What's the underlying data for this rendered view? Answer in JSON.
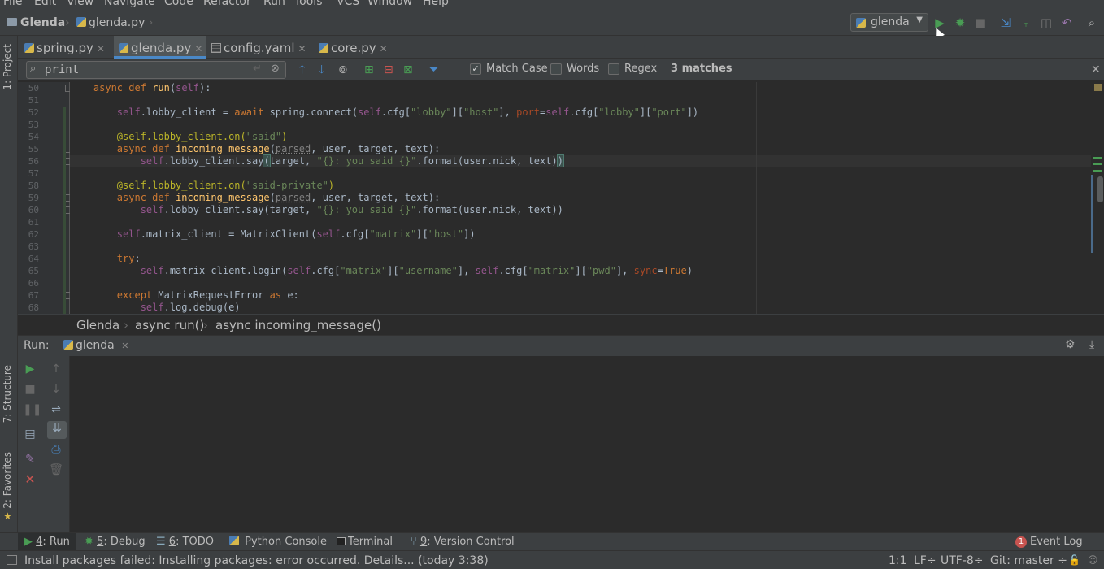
{
  "menu": [
    "File",
    "Edit",
    "View",
    "Navigate",
    "Code",
    "Refactor",
    "Run",
    "Tools",
    "VCS",
    "Window",
    "Help"
  ],
  "navbar": {
    "project": "Glenda",
    "file": "glenda.py",
    "run_config": "glenda"
  },
  "tool_windows": {
    "project": "1: Project",
    "structure": "7: Structure",
    "favorites": "2: Favorites"
  },
  "tabs": [
    {
      "label": "spring.py",
      "icon": "python-file-icon"
    },
    {
      "label": "glenda.py",
      "icon": "python-file-icon",
      "active": true
    },
    {
      "label": "config.yaml",
      "icon": "yaml-file-icon"
    },
    {
      "label": "core.py",
      "icon": "python-file-icon"
    }
  ],
  "find": {
    "query": "print",
    "match_case": true,
    "match_case_label": "Match Case",
    "words": false,
    "words_label": "Words",
    "regex": false,
    "regex_label": "Regex",
    "result": "3 matches"
  },
  "editor": {
    "line_numbers": [
      "50",
      "51",
      "52",
      "53",
      "54",
      "55",
      "56",
      "57",
      "58",
      "59",
      "60",
      "61",
      "62",
      "63",
      "64",
      "65",
      "66",
      "67",
      "68"
    ],
    "current_line": "56"
  },
  "breadcrumbs": [
    "Glenda",
    "async run()",
    "async incoming_message()"
  ],
  "run_panel": {
    "title": "Run:",
    "tab": "glenda"
  },
  "bottom_tabs": [
    {
      "num": "4",
      "label": ": Run"
    },
    {
      "num": "5",
      "label": ": Debug"
    },
    {
      "num": "6",
      "label": ": TODO"
    },
    {
      "num": "",
      "label": "Python Console"
    },
    {
      "num": "",
      "label": "Terminal"
    },
    {
      "num": "9",
      "label": ": Version Control"
    }
  ],
  "event_log": {
    "label": "Event Log",
    "count": "1"
  },
  "status": {
    "message": "Install packages failed: Installing packages: error occurred. Details... (today 3:38)",
    "position": "1:1",
    "line_sep": "LF÷",
    "encoding": "UTF-8÷",
    "vcs": "Git: master ÷"
  },
  "colors": {
    "keyword": "#cc7832",
    "string": "#6a8759",
    "self": "#94558d",
    "function": "#ffc66d",
    "decorator": "#bbb529",
    "accent": "#4a88c7",
    "run_green": "#499c54",
    "error_red": "#c75450"
  }
}
